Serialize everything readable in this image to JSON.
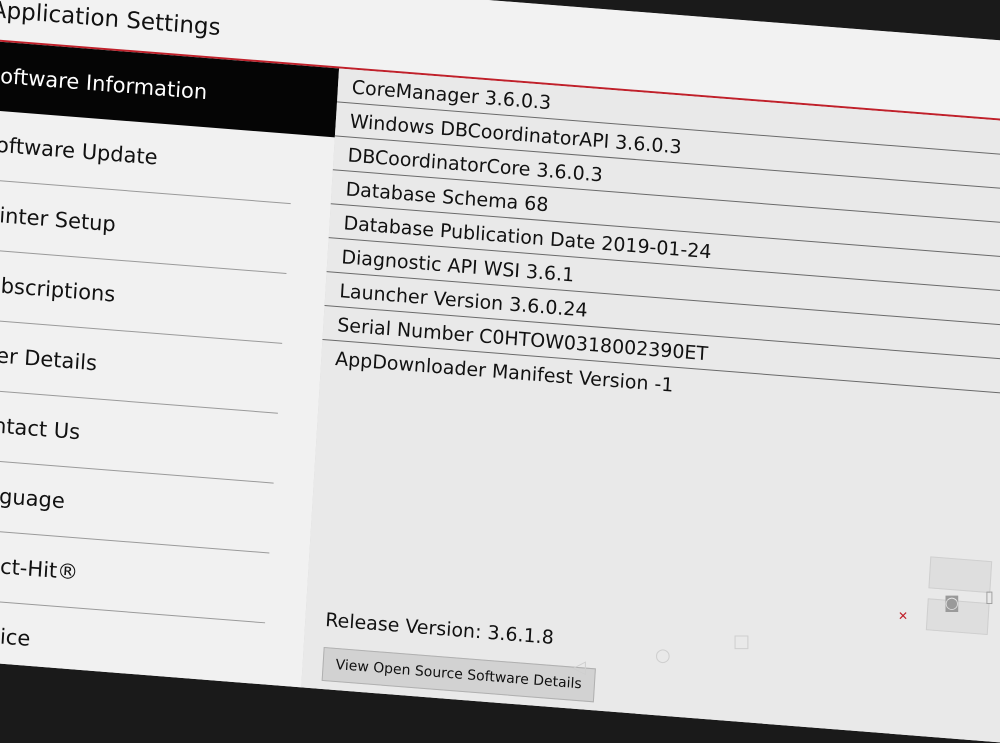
{
  "header": {
    "title": "Application Settings"
  },
  "sidebar": {
    "items": [
      {
        "label": "Software Information",
        "active": true
      },
      {
        "label": "Software Update"
      },
      {
        "label": "Printer Setup"
      },
      {
        "label": "Subscriptions"
      },
      {
        "label": "User Details"
      },
      {
        "label": "Contact Us"
      },
      {
        "label": "Language"
      },
      {
        "label": "Direct-Hit®"
      },
      {
        "label": "Service"
      }
    ]
  },
  "info": {
    "rows": [
      "CoreManager 3.6.0.3",
      "Windows DBCoordinatorAPI 3.6.0.3",
      "DBCoordinatorCore 3.6.0.3",
      "Database Schema 68",
      "Database Publication Date 2019-01-24",
      "Diagnostic API WSI 3.6.1",
      "Launcher Version 3.6.0.24",
      "Serial Number C0HTOW0318002390ET",
      "AppDownloader Manifest Version -1"
    ],
    "release_version": "Release Version: 3.6.1.8",
    "oss_button": "View Open Source Software Details"
  },
  "navbar": {
    "back_icon": "back-triangle-icon",
    "home_icon": "home-circle-icon",
    "recents_icon": "recents-square-icon"
  },
  "colors": {
    "accent": "#c0202a",
    "active_bg": "#050505",
    "panel_bg": "#e9e9e9"
  }
}
